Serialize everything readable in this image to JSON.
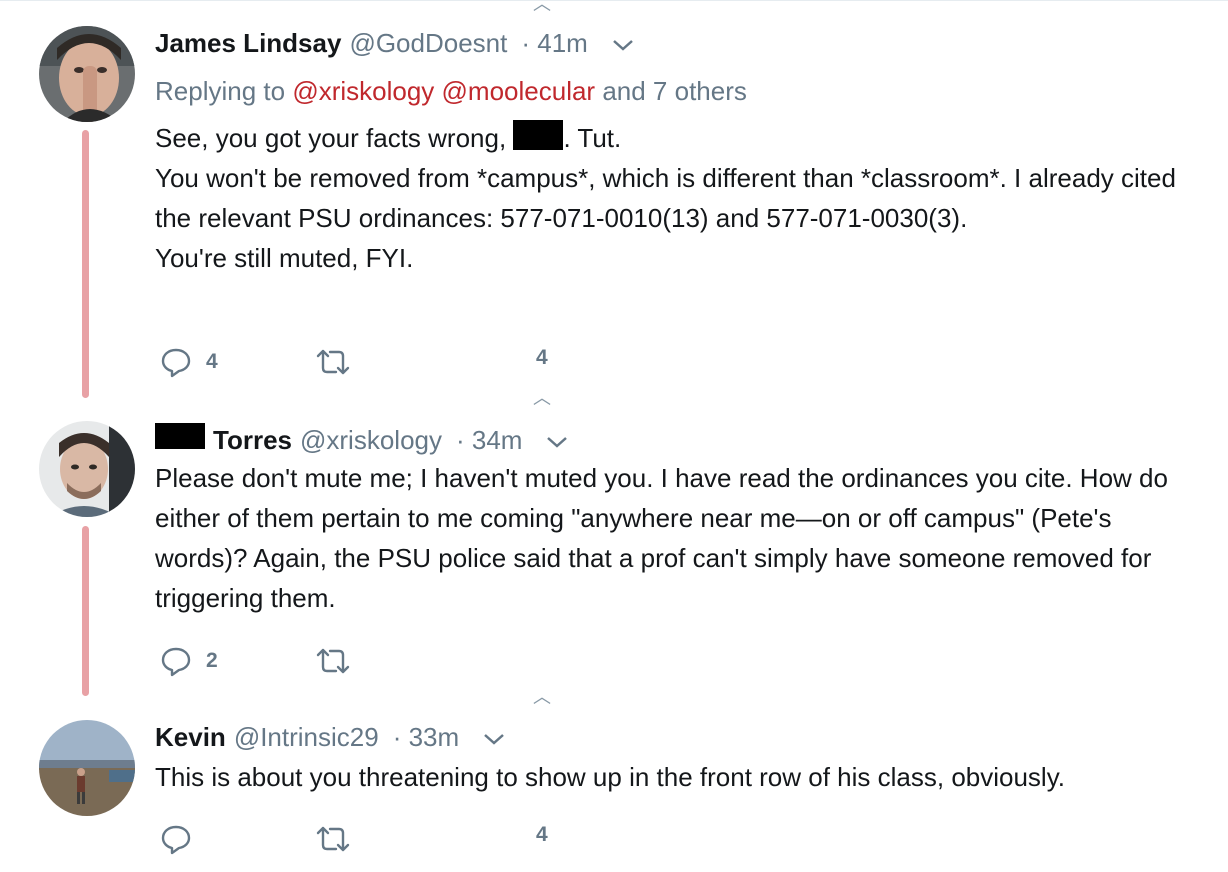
{
  "thread": [
    {
      "name": "James Lindsay",
      "handle": "@GodDoesnt",
      "time": "· 41m",
      "replying_prefix": "Replying to ",
      "replying_links": [
        "@xriskology",
        "@moolecular"
      ],
      "replying_suffix": " and 7 others",
      "lines": [
        "See, you got your facts wrong,",
        ". Tut.",
        "You won't be removed from *campus*, which is different than *classroom*. I already cited the relevant PSU ordinances: 577-071-0010(13) and 577-071-0030(3).",
        "You're still muted, FYI."
      ],
      "reply_count": "4",
      "like_count": "4"
    },
    {
      "name": "Torres",
      "handle": "@xriskology",
      "time": "· 34m",
      "text": "Please don't mute me; I haven't muted you. I have read the ordinances you cite. How do either of them pertain to me coming \"anywhere near me—on or off campus\" (Pete's words)? Again, the PSU police said that a prof can't simply have someone removed for triggering them.",
      "reply_count": "2"
    },
    {
      "name": "Kevin",
      "handle": "@Intrinsic29",
      "time": "· 33m",
      "text": "This is about you threatening to show up in the front row of his class, obviously.",
      "like_count": "4"
    }
  ],
  "icons": {
    "reply": "reply-icon",
    "retweet": "retweet-icon",
    "like": "like-icon",
    "caret": "chevron-down-icon",
    "more": "show-more-icon"
  },
  "colors": {
    "thread_line": "#e8a1a5",
    "link": "#c0282d",
    "secondary_text": "#657786",
    "redaction": "#000000"
  }
}
